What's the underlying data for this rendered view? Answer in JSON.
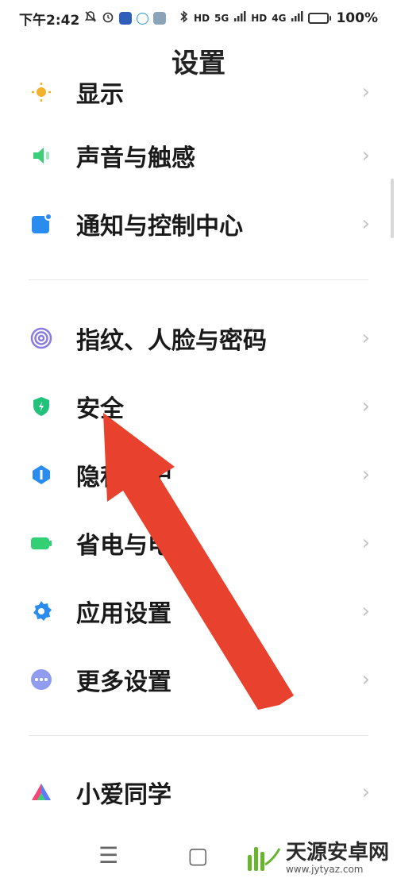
{
  "status_bar": {
    "time": "下午2:42",
    "battery_percent": "100%",
    "battery_level": 1.0,
    "network_5g": "5G",
    "network_4g": "4G",
    "hd1": "HD",
    "hd2": "HD",
    "icons": [
      "bell-off-icon",
      "alarm-icon",
      "app-badge-icon",
      "k-badge-icon",
      "gear-badge-icon",
      "bluetooth-icon",
      "signal-icon",
      "battery-icon"
    ]
  },
  "page": {
    "title": "设置"
  },
  "items": [
    {
      "label": "显示",
      "icon": "sun-icon",
      "color": "#f3b22d"
    },
    {
      "label": "声音与触感",
      "icon": "speaker-icon",
      "color": "#3ccf7a"
    },
    {
      "label": "通知与控制中心",
      "icon": "notification-icon",
      "color": "#2b8cf0"
    },
    {
      "label": "指纹、人脸与密码",
      "icon": "fingerprint-icon",
      "color": "#8a7be0"
    },
    {
      "label": "安全",
      "icon": "shield-icon",
      "color": "#22c27a"
    },
    {
      "label": "隐私保护",
      "icon": "privacy-icon",
      "color": "#2b8cf0"
    },
    {
      "label": "省电与电池",
      "icon": "battery-icon",
      "color": "#33cf74"
    },
    {
      "label": "应用设置",
      "icon": "gear-icon",
      "color": "#2b8cf0"
    },
    {
      "label": "更多设置",
      "icon": "more-icon",
      "color": "#8f9cf0"
    },
    {
      "label": "小爱同学",
      "icon": "xiaoai-icon",
      "color": "#5b7cf5"
    }
  ],
  "chevron": "›",
  "nav": {
    "menu": "☰",
    "home": "▢",
    "back": "◁"
  },
  "watermark": {
    "name": "天源安卓网",
    "url": "www.jytyaz.com"
  },
  "arrow_color": "#e8412d"
}
